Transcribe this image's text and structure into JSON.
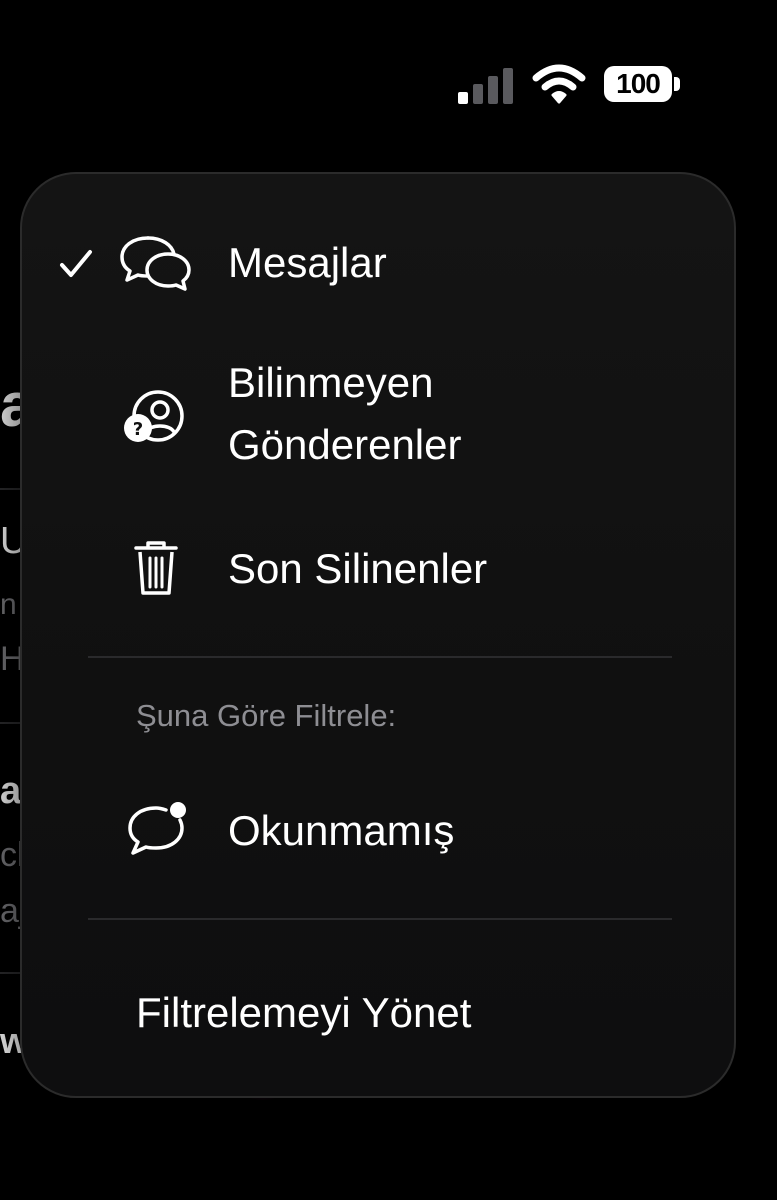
{
  "status_bar": {
    "battery_level": "100"
  },
  "background_peek": {
    "items": [
      "a",
      "U",
      "n",
      "H",
      "a",
      "cl",
      "aj",
      "we"
    ]
  },
  "menu": {
    "items": [
      {
        "label": "Mesajlar",
        "icon": "chat-bubbles-icon",
        "checked": true
      },
      {
        "label_line1": "Bilinmeyen",
        "label_line2": "Gönderenler",
        "icon": "unknown-person-icon",
        "checked": false
      },
      {
        "label": "Son Silinenler",
        "icon": "trash-icon",
        "checked": false
      }
    ],
    "filter_section": {
      "header": "Şuna Göre Filtrele:",
      "items": [
        {
          "label": "Okunmamış",
          "icon": "unread-bubble-icon"
        }
      ]
    },
    "manage_label": "Filtrelemeyi Yönet"
  }
}
